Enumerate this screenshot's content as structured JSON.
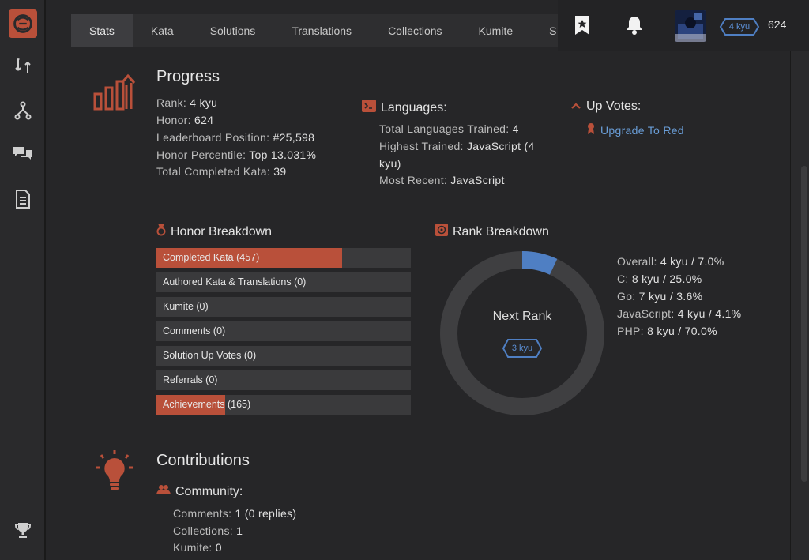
{
  "tabs": [
    "Stats",
    "Kata",
    "Solutions",
    "Translations",
    "Collections",
    "Kumite",
    "S"
  ],
  "topbar": {
    "rank_badge": "4 kyu",
    "honor": "624"
  },
  "progress": {
    "title": "Progress",
    "stats": [
      {
        "label": "Rank:",
        "value": "4 kyu"
      },
      {
        "label": "Honor:",
        "value": "624"
      },
      {
        "label": "Leaderboard Position:",
        "value": "#25,598"
      },
      {
        "label": "Honor Percentile:",
        "value": "Top 13.031%"
      },
      {
        "label": "Total Completed Kata:",
        "value": "39"
      }
    ]
  },
  "languages": {
    "title": "Languages:",
    "total_label": "Total Languages Trained:",
    "total_value": "4",
    "highest_label": "Highest Trained:",
    "highest_value": "JavaScript (4",
    "highest_value_2": "kyu)",
    "recent_label": "Most Recent:",
    "recent_value": "JavaScript"
  },
  "upvotes": {
    "title": "Up Votes:",
    "link": "Upgrade To Red"
  },
  "honor_breakdown": {
    "title": "Honor Breakdown",
    "bars": [
      {
        "label": "Completed Kata (457)",
        "fraction": 0.73
      },
      {
        "label": "Authored Kata & Translations (0)",
        "fraction": 0
      },
      {
        "label": "Kumite (0)",
        "fraction": 0
      },
      {
        "label": "Comments (0)",
        "fraction": 0
      },
      {
        "label": "Solution Up Votes (0)",
        "fraction": 0
      },
      {
        "label": "Referrals (0)",
        "fraction": 0
      },
      {
        "label": "Achievements (165)",
        "fraction": 0.27
      }
    ]
  },
  "rank_breakdown": {
    "title": "Rank Breakdown",
    "center_label": "Next Rank",
    "next_rank": "3 kyu",
    "progress_fraction": 0.07,
    "items": [
      {
        "label": "Overall:",
        "value": "4 kyu / 7.0%"
      },
      {
        "label": "C:",
        "value": "8 kyu / 25.0%"
      },
      {
        "label": "Go:",
        "value": "7 kyu / 3.6%"
      },
      {
        "label": "JavaScript:",
        "value": "4 kyu / 4.1%"
      },
      {
        "label": "PHP:",
        "value": "8 kyu / 70.0%"
      }
    ]
  },
  "contributions": {
    "title": "Contributions",
    "community_title": "Community:",
    "items": [
      {
        "label": "Comments:",
        "value": "1 (0 replies)"
      },
      {
        "label": "Collections:",
        "value": "1"
      },
      {
        "label": "Kumite:",
        "value": "0"
      }
    ]
  },
  "colors": {
    "accent": "#b9503a",
    "link": "#6a9ed8",
    "ring_track": "#3f3f41",
    "ring_fill": "#4f7fc3"
  }
}
